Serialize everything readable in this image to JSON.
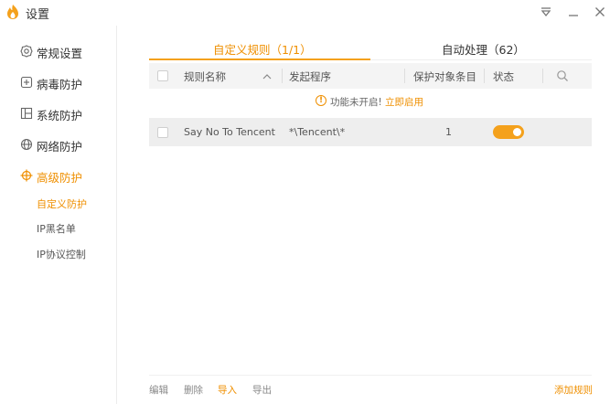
{
  "window": {
    "title": "设置",
    "icons": {
      "logo": "app-flame-logo-icon",
      "menu": "menu-dropdown-icon",
      "minimize": "minimize-icon",
      "close": "close-icon"
    }
  },
  "sidebar": {
    "items": [
      {
        "label": "常规设置",
        "icon": "gear-icon"
      },
      {
        "label": "病毒防护",
        "icon": "plus-square-icon"
      },
      {
        "label": "系统防护",
        "icon": "system-grid-icon"
      },
      {
        "label": "网络防护",
        "icon": "globe-icon"
      },
      {
        "label": "高级防护",
        "icon": "crosshair-icon",
        "active": true
      }
    ],
    "subitems": [
      {
        "label": "自定义防护",
        "active": true
      },
      {
        "label": "IP黑名单"
      },
      {
        "label": "IP协议控制"
      }
    ]
  },
  "tabs": [
    {
      "label": "自定义规则（1/1）",
      "active": true
    },
    {
      "label": "自动处理（62）"
    }
  ],
  "table": {
    "columns": [
      "规则名称",
      "发起程序",
      "保护对象条目",
      "状态"
    ],
    "sort_icon": "chevron-up-icon",
    "search_icon": "search-icon",
    "rows": [
      {
        "name": "Say No To Tencent",
        "program": "*\\Tencent\\*",
        "count": "1",
        "enabled": true
      }
    ]
  },
  "notice": {
    "icon": "warning-circle-icon",
    "text": "功能未开启!",
    "link": "立即启用"
  },
  "footer": {
    "edit": "编辑",
    "delete": "删除",
    "import": "导入",
    "export": "导出",
    "add_rule": "添加规则"
  },
  "colors": {
    "accent": "#f4a11c",
    "accent_text": "#ef8f00",
    "row_bg": "#eeeeee",
    "header_bg": "#f4f4f4"
  }
}
